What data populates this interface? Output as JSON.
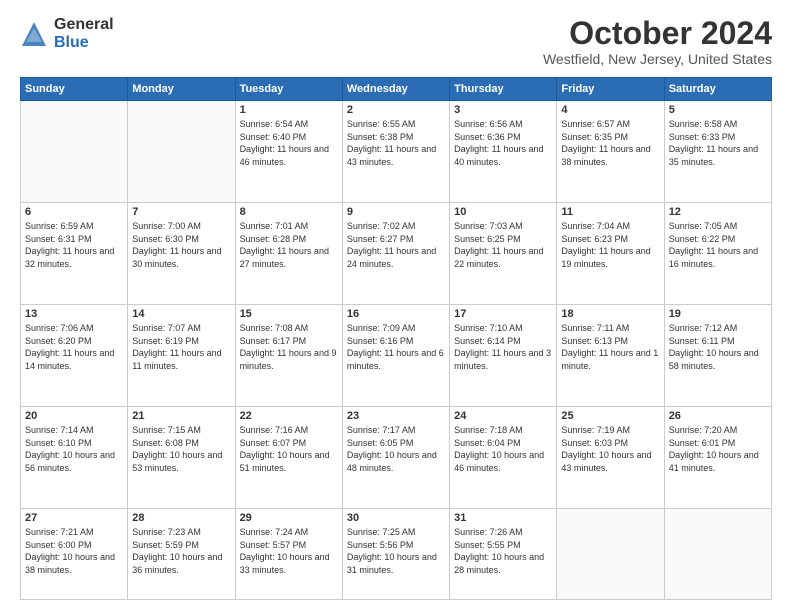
{
  "logo": {
    "general": "General",
    "blue": "Blue"
  },
  "header": {
    "month": "October 2024",
    "location": "Westfield, New Jersey, United States"
  },
  "weekdays": [
    "Sunday",
    "Monday",
    "Tuesday",
    "Wednesday",
    "Thursday",
    "Friday",
    "Saturday"
  ],
  "weeks": [
    [
      {
        "day": "",
        "info": ""
      },
      {
        "day": "",
        "info": ""
      },
      {
        "day": "1",
        "info": "Sunrise: 6:54 AM\nSunset: 6:40 PM\nDaylight: 11 hours and 46 minutes."
      },
      {
        "day": "2",
        "info": "Sunrise: 6:55 AM\nSunset: 6:38 PM\nDaylight: 11 hours and 43 minutes."
      },
      {
        "day": "3",
        "info": "Sunrise: 6:56 AM\nSunset: 6:36 PM\nDaylight: 11 hours and 40 minutes."
      },
      {
        "day": "4",
        "info": "Sunrise: 6:57 AM\nSunset: 6:35 PM\nDaylight: 11 hours and 38 minutes."
      },
      {
        "day": "5",
        "info": "Sunrise: 6:58 AM\nSunset: 6:33 PM\nDaylight: 11 hours and 35 minutes."
      }
    ],
    [
      {
        "day": "6",
        "info": "Sunrise: 6:59 AM\nSunset: 6:31 PM\nDaylight: 11 hours and 32 minutes."
      },
      {
        "day": "7",
        "info": "Sunrise: 7:00 AM\nSunset: 6:30 PM\nDaylight: 11 hours and 30 minutes."
      },
      {
        "day": "8",
        "info": "Sunrise: 7:01 AM\nSunset: 6:28 PM\nDaylight: 11 hours and 27 minutes."
      },
      {
        "day": "9",
        "info": "Sunrise: 7:02 AM\nSunset: 6:27 PM\nDaylight: 11 hours and 24 minutes."
      },
      {
        "day": "10",
        "info": "Sunrise: 7:03 AM\nSunset: 6:25 PM\nDaylight: 11 hours and 22 minutes."
      },
      {
        "day": "11",
        "info": "Sunrise: 7:04 AM\nSunset: 6:23 PM\nDaylight: 11 hours and 19 minutes."
      },
      {
        "day": "12",
        "info": "Sunrise: 7:05 AM\nSunset: 6:22 PM\nDaylight: 11 hours and 16 minutes."
      }
    ],
    [
      {
        "day": "13",
        "info": "Sunrise: 7:06 AM\nSunset: 6:20 PM\nDaylight: 11 hours and 14 minutes."
      },
      {
        "day": "14",
        "info": "Sunrise: 7:07 AM\nSunset: 6:19 PM\nDaylight: 11 hours and 11 minutes."
      },
      {
        "day": "15",
        "info": "Sunrise: 7:08 AM\nSunset: 6:17 PM\nDaylight: 11 hours and 9 minutes."
      },
      {
        "day": "16",
        "info": "Sunrise: 7:09 AM\nSunset: 6:16 PM\nDaylight: 11 hours and 6 minutes."
      },
      {
        "day": "17",
        "info": "Sunrise: 7:10 AM\nSunset: 6:14 PM\nDaylight: 11 hours and 3 minutes."
      },
      {
        "day": "18",
        "info": "Sunrise: 7:11 AM\nSunset: 6:13 PM\nDaylight: 11 hours and 1 minute."
      },
      {
        "day": "19",
        "info": "Sunrise: 7:12 AM\nSunset: 6:11 PM\nDaylight: 10 hours and 58 minutes."
      }
    ],
    [
      {
        "day": "20",
        "info": "Sunrise: 7:14 AM\nSunset: 6:10 PM\nDaylight: 10 hours and 56 minutes."
      },
      {
        "day": "21",
        "info": "Sunrise: 7:15 AM\nSunset: 6:08 PM\nDaylight: 10 hours and 53 minutes."
      },
      {
        "day": "22",
        "info": "Sunrise: 7:16 AM\nSunset: 6:07 PM\nDaylight: 10 hours and 51 minutes."
      },
      {
        "day": "23",
        "info": "Sunrise: 7:17 AM\nSunset: 6:05 PM\nDaylight: 10 hours and 48 minutes."
      },
      {
        "day": "24",
        "info": "Sunrise: 7:18 AM\nSunset: 6:04 PM\nDaylight: 10 hours and 46 minutes."
      },
      {
        "day": "25",
        "info": "Sunrise: 7:19 AM\nSunset: 6:03 PM\nDaylight: 10 hours and 43 minutes."
      },
      {
        "day": "26",
        "info": "Sunrise: 7:20 AM\nSunset: 6:01 PM\nDaylight: 10 hours and 41 minutes."
      }
    ],
    [
      {
        "day": "27",
        "info": "Sunrise: 7:21 AM\nSunset: 6:00 PM\nDaylight: 10 hours and 38 minutes."
      },
      {
        "day": "28",
        "info": "Sunrise: 7:23 AM\nSunset: 5:59 PM\nDaylight: 10 hours and 36 minutes."
      },
      {
        "day": "29",
        "info": "Sunrise: 7:24 AM\nSunset: 5:57 PM\nDaylight: 10 hours and 33 minutes."
      },
      {
        "day": "30",
        "info": "Sunrise: 7:25 AM\nSunset: 5:56 PM\nDaylight: 10 hours and 31 minutes."
      },
      {
        "day": "31",
        "info": "Sunrise: 7:26 AM\nSunset: 5:55 PM\nDaylight: 10 hours and 28 minutes."
      },
      {
        "day": "",
        "info": ""
      },
      {
        "day": "",
        "info": ""
      }
    ]
  ]
}
